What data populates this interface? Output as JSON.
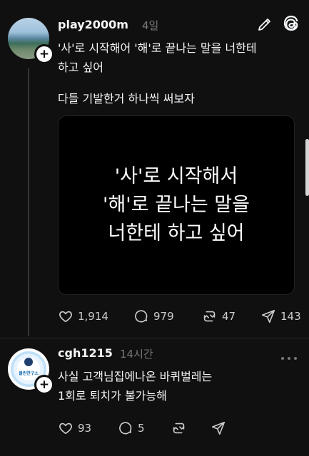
{
  "post": {
    "username": "play2000m",
    "time": "4일",
    "text_line1": "'사'로 시작해어 '해'로 끝나는 말을 너한테",
    "text_line2": "하고 싶어",
    "text_line3": "다들 기발한거 하나씩 써보자",
    "image_text": {
      "line1": "'사'로 시작해서",
      "line2": "'해'로 끝나는 말을",
      "line3": "너한테 하고 싶어"
    },
    "actions": {
      "likes": "1,914",
      "comments": "979",
      "reposts": "47",
      "shares": "143"
    }
  },
  "reply": {
    "username": "cgh1215",
    "time": "14시간",
    "avatar_label": "클린연구소",
    "text_line1": "사실 고객님집에나온 바퀴벌레는",
    "text_line2": "1회로 퇴치가 불가능해",
    "actions": {
      "likes": "93",
      "comments": "5"
    }
  },
  "colors": {
    "background": "#101010",
    "text": "#f3f5f7",
    "muted": "#777777",
    "line": "#333638"
  }
}
